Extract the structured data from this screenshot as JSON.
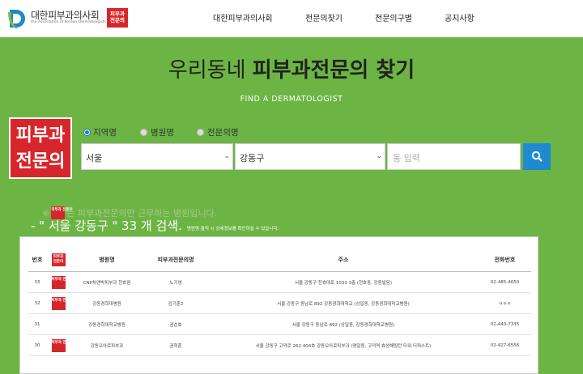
{
  "header": {
    "logo_title": "대한피부과의사회",
    "logo_subtitle": "the Association of Korean Dermatologists",
    "logo_badge": "피부과 전문의",
    "nav": [
      "대한피부과의사회",
      "전문의찾기",
      "전문의구별",
      "공지사항"
    ]
  },
  "hero": {
    "title_light": "우리동네 ",
    "title_bold": "피부과전문의 찾기",
    "subtitle": "FIND A DERMATOLOGIST"
  },
  "big_badge": {
    "line1": "피부과",
    "line2": "전문의"
  },
  "radios": [
    {
      "label": "지역명",
      "checked": true
    },
    {
      "label": "병원명",
      "checked": false
    },
    {
      "label": "전문의명",
      "checked": false
    }
  ],
  "search": {
    "region": "서울",
    "district": "강동구",
    "placeholder": "동 입력"
  },
  "notice": {
    "prefix": "※",
    "badge": "피부과 전문의",
    "text": "는 피부과전문의만 근무하는 병원입니다."
  },
  "result": {
    "text": "- \" 서울 강동구 \" 33 개 검색.",
    "hint": "병원명 클릭 시 상세정보를 확인하실 수 있습니다."
  },
  "table": {
    "headers": [
      "번호",
      "병원명",
      "피부과전문의명",
      "주소",
      "전화번호"
    ],
    "header_badge": "피부과 전문의",
    "rows": [
      {
        "no": "33",
        "badge": true,
        "name": "CNP차앤박피부과 천호점",
        "doctor": "노기영",
        "address": "서울 강동구 천호대로 1033 3층 (천호동, 강동빌딩)",
        "phone": "02-485-4650"
      },
      {
        "no": "32",
        "badge": true,
        "name": "강동경희대병원",
        "doctor": "김기훈2",
        "address": "서울 강동구 동남로 892 강동경희대학교 (상일동, 강동경희대학교병원)",
        "phone": "ㅁㅁㅁ"
      },
      {
        "no": "31",
        "badge": false,
        "name": "강동경희대학교병원",
        "doctor": "권순효",
        "address": "서울 강동구 동남로 892 (상일동, 강동경희대학교병원)",
        "phone": "02-440-7335"
      },
      {
        "no": "30",
        "badge": true,
        "name": "강동오아로피부과",
        "doctor": "권혁훈",
        "address": "서울 강동구 고덕로 262 404호 강동오아로피부과 (명일동, 고덕역 효성해링턴 타워 더퍼스트)",
        "phone": "02-427-6556"
      }
    ]
  },
  "colors": {
    "background": "#6cb544",
    "brand_red": "#d7262b",
    "search_blue": "#1f8ad1"
  }
}
